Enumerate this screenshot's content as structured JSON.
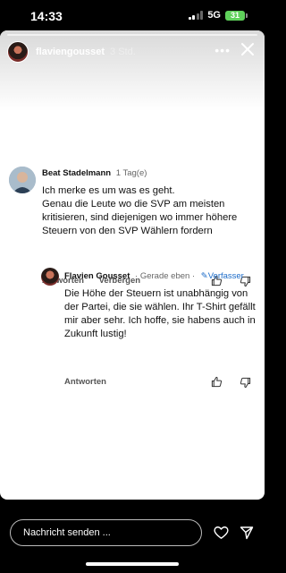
{
  "status": {
    "time": "14:33",
    "network": "5G",
    "battery": "31"
  },
  "story": {
    "username": "flaviengousset",
    "time_ago": "3 Std."
  },
  "comments": [
    {
      "author": "Beat Stadelmann",
      "meta": "1 Tag(e)",
      "text": "Ich merke es um was es geht.\nGenau die Leute wo die SVP am meisten kritisieren, sind diejenigen wo immer höhere Steuern von den SVP Wählern fordern",
      "reply_label": "Antworten",
      "hide_label": "Verbergen"
    },
    {
      "author": "Flavien Gousset",
      "meta": "· Gerade eben ·",
      "badge": "Verfasser",
      "text": "Die Höhe der Steuern ist unabhängig von der Partei, die sie wählen. Ihr T-Shirt gefällt mir aber sehr. Ich hoffe, sie habens auch in Zukunft lustig!",
      "reply_label": "Antworten"
    }
  ],
  "message_placeholder": "Nachricht senden ...",
  "icons": [
    "like-icon",
    "dislike-icon",
    "heart-icon",
    "send-icon",
    "close-icon",
    "more-icon"
  ]
}
